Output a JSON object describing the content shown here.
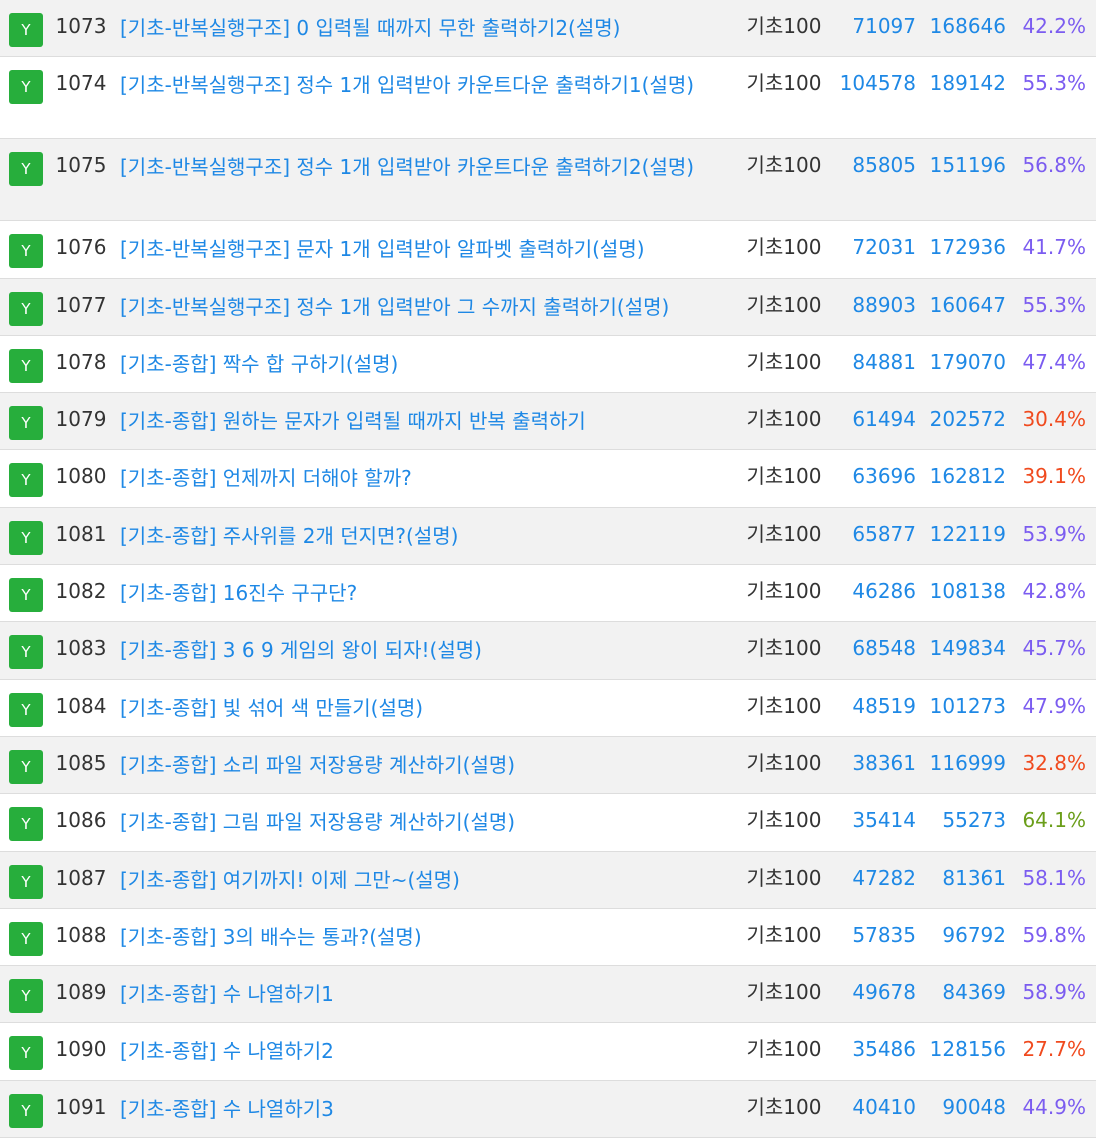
{
  "badge_label": "Y",
  "colors": {
    "badge": "#27ae3c",
    "link": "#1e88e5",
    "rate_mid": "#7b5cf0",
    "rate_low": "#f04a1e",
    "rate_high": "#6b9e1a"
  },
  "rows": [
    {
      "id": "1073",
      "title": "[기초-반복실행구조] 0 입력될 때까지 무한 출력하기2(설명)",
      "category": "기초100",
      "solved": "71097",
      "submitted": "168646",
      "rate": "42.2%"
    },
    {
      "id": "1074",
      "title": "[기초-반복실행구조] 정수 1개 입력받아 카운트다운 출력하기1(설명)",
      "category": "기초100",
      "solved": "104578",
      "submitted": "189142",
      "rate": "55.3%"
    },
    {
      "id": "1075",
      "title": "[기초-반복실행구조] 정수 1개 입력받아 카운트다운 출력하기2(설명)",
      "category": "기초100",
      "solved": "85805",
      "submitted": "151196",
      "rate": "56.8%"
    },
    {
      "id": "1076",
      "title": "[기초-반복실행구조] 문자 1개 입력받아 알파벳 출력하기(설명)",
      "category": "기초100",
      "solved": "72031",
      "submitted": "172936",
      "rate": "41.7%"
    },
    {
      "id": "1077",
      "title": "[기초-반복실행구조] 정수 1개 입력받아 그 수까지 출력하기(설명)",
      "category": "기초100",
      "solved": "88903",
      "submitted": "160647",
      "rate": "55.3%"
    },
    {
      "id": "1078",
      "title": "[기초-종합] 짝수 합 구하기(설명)",
      "category": "기초100",
      "solved": "84881",
      "submitted": "179070",
      "rate": "47.4%"
    },
    {
      "id": "1079",
      "title": "[기초-종합] 원하는 문자가 입력될 때까지 반복 출력하기",
      "category": "기초100",
      "solved": "61494",
      "submitted": "202572",
      "rate": "30.4%"
    },
    {
      "id": "1080",
      "title": "[기초-종합] 언제까지 더해야 할까?",
      "category": "기초100",
      "solved": "63696",
      "submitted": "162812",
      "rate": "39.1%"
    },
    {
      "id": "1081",
      "title": "[기초-종합] 주사위를 2개 던지면?(설명)",
      "category": "기초100",
      "solved": "65877",
      "submitted": "122119",
      "rate": "53.9%"
    },
    {
      "id": "1082",
      "title": "[기초-종합] 16진수 구구단?",
      "category": "기초100",
      "solved": "46286",
      "submitted": "108138",
      "rate": "42.8%"
    },
    {
      "id": "1083",
      "title": "[기초-종합] 3 6 9 게임의 왕이 되자!(설명)",
      "category": "기초100",
      "solved": "68548",
      "submitted": "149834",
      "rate": "45.7%"
    },
    {
      "id": "1084",
      "title": "[기초-종합] 빛 섞어 색 만들기(설명)",
      "category": "기초100",
      "solved": "48519",
      "submitted": "101273",
      "rate": "47.9%"
    },
    {
      "id": "1085",
      "title": "[기초-종합] 소리 파일 저장용량 계산하기(설명)",
      "category": "기초100",
      "solved": "38361",
      "submitted": "116999",
      "rate": "32.8%"
    },
    {
      "id": "1086",
      "title": "[기초-종합] 그림 파일 저장용량 계산하기(설명)",
      "category": "기초100",
      "solved": "35414",
      "submitted": "55273",
      "rate": "64.1%"
    },
    {
      "id": "1087",
      "title": "[기초-종합] 여기까지! 이제 그만~(설명)",
      "category": "기초100",
      "solved": "47282",
      "submitted": "81361",
      "rate": "58.1%"
    },
    {
      "id": "1088",
      "title": "[기초-종합] 3의 배수는 통과?(설명)",
      "category": "기초100",
      "solved": "57835",
      "submitted": "96792",
      "rate": "59.8%"
    },
    {
      "id": "1089",
      "title": "[기초-종합] 수 나열하기1",
      "category": "기초100",
      "solved": "49678",
      "submitted": "84369",
      "rate": "58.9%"
    },
    {
      "id": "1090",
      "title": "[기초-종합] 수 나열하기2",
      "category": "기초100",
      "solved": "35486",
      "submitted": "128156",
      "rate": "27.7%"
    },
    {
      "id": "1091",
      "title": "[기초-종합] 수 나열하기3",
      "category": "기초100",
      "solved": "40410",
      "submitted": "90048",
      "rate": "44.9%"
    }
  ]
}
